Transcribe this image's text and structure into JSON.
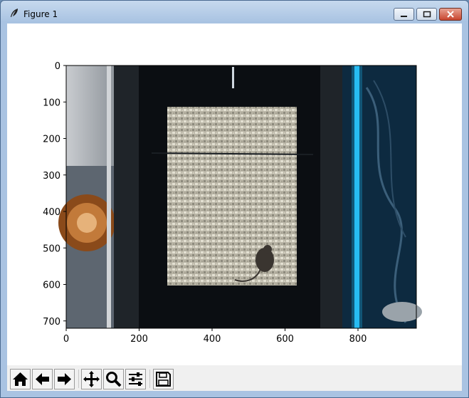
{
  "window": {
    "title": "Figure 1",
    "icon": "feather-icon",
    "controls": [
      "minimize-icon",
      "maximize-icon",
      "close-icon"
    ],
    "accent": "#c8452f"
  },
  "chart_data": {
    "type": "image",
    "title": "",
    "xlabel": "",
    "ylabel": "",
    "xlim": [
      0,
      960
    ],
    "ylim": [
      720,
      0
    ],
    "xticks": [
      0,
      200,
      400,
      600,
      800
    ],
    "yticks": [
      0,
      100,
      200,
      300,
      400,
      500,
      600,
      700
    ],
    "image_description": "overhead camera view of a mouse in a bedding-filled arena",
    "grid": false
  },
  "toolbar": {
    "buttons": [
      {
        "name": "home-button",
        "icon": "home-icon"
      },
      {
        "name": "back-button",
        "icon": "arrow-left-icon"
      },
      {
        "name": "forward-button",
        "icon": "arrow-right-icon"
      },
      {
        "name": "pan-button",
        "icon": "move-icon"
      },
      {
        "name": "zoom-button",
        "icon": "magnifier-icon"
      },
      {
        "name": "configure-subplots-button",
        "icon": "sliders-icon"
      },
      {
        "name": "save-button",
        "icon": "floppy-disk-icon"
      }
    ]
  }
}
